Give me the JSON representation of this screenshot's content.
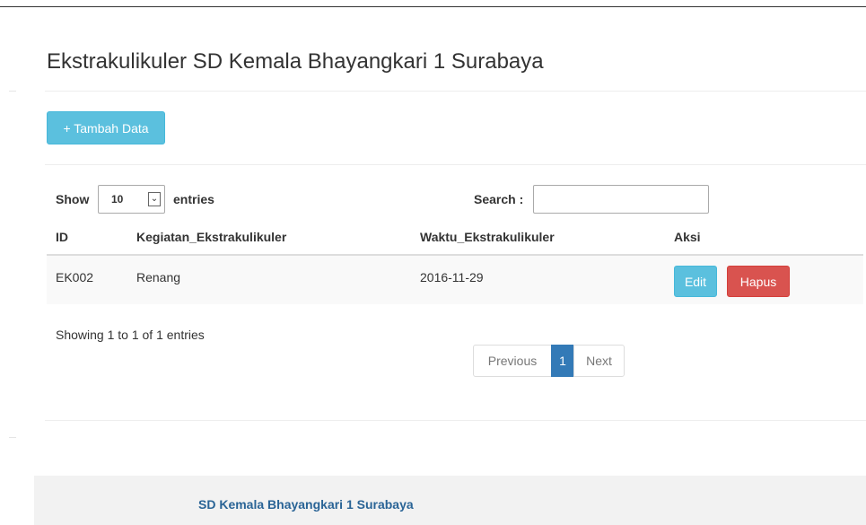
{
  "page": {
    "title": "Ekstrakulikuler SD Kemala Bhayangkari 1 Surabaya"
  },
  "toolbar": {
    "add_label": "+ Tambah Data"
  },
  "table_controls": {
    "show_label": "Show",
    "entries_value": "10",
    "entries_label": "entries",
    "search_label": "Search :",
    "search_value": ""
  },
  "table": {
    "columns": [
      "ID",
      "Kegiatan_Ekstrakulikuler",
      "Waktu_Ekstrakulikuler",
      "Aksi"
    ],
    "rows": [
      {
        "id": "EK002",
        "kegiatan": "Renang",
        "waktu": "2016-11-29",
        "edit_label": "Edit",
        "delete_label": "Hapus"
      }
    ]
  },
  "info": "Showing 1 to 1 of 1 entries",
  "pagination": {
    "previous": "Previous",
    "current": "1",
    "next": "Next"
  },
  "footer": {
    "text": "SD Kemala Bhayangkari 1 Surabaya"
  },
  "colors": {
    "info_button": "#5bc0de",
    "danger_button": "#d9534f",
    "active_page": "#337ab7",
    "footer_link": "#2a6496"
  }
}
